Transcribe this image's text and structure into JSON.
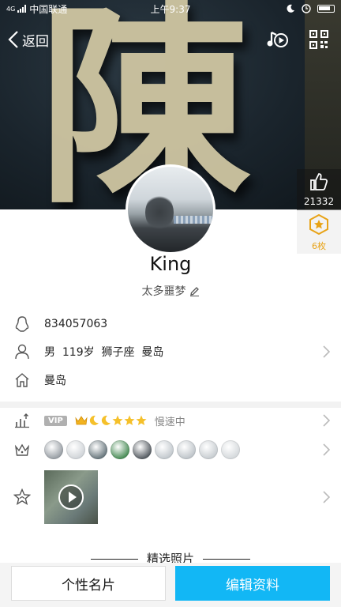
{
  "status_bar": {
    "network": "4G",
    "carrier": "中国联通",
    "time": "上午9:37"
  },
  "top_bar": {
    "back_label": "返回"
  },
  "cover": {
    "glyph": "陳"
  },
  "stats": {
    "likes": "21332",
    "badges": "6枚"
  },
  "profile": {
    "name": "King",
    "signature": "太多噩梦"
  },
  "info": {
    "qq_number": "834057063",
    "personal": "男  119岁  狮子座  曼岛",
    "hometown": "曼岛"
  },
  "level": {
    "vip_label": "VIP",
    "speed_text": "慢速中"
  },
  "medals": [
    {
      "icon": "penguin-medal-icon",
      "color": "#9aa0a6"
    },
    {
      "icon": "diamond-live-medal-icon",
      "color": "#d0d4d8"
    },
    {
      "icon": "penguin-star-medal-icon",
      "color": "#6c7a80"
    },
    {
      "icon": "penguin-gem-medal-icon",
      "color": "#4d8f5a"
    },
    {
      "icon": "penguin-crown-medal-icon",
      "color": "#5a6066"
    },
    {
      "icon": "vip-badge-medal-icon",
      "color": "#c3c9ce"
    },
    {
      "icon": "diamond-medal-icon",
      "color": "#bfc5ca"
    },
    {
      "icon": "star-medal-icon",
      "color": "#c8cdd1"
    },
    {
      "icon": "lightning-medal-icon",
      "color": "#d5d9dc"
    }
  ],
  "section": {
    "featured_title": "精选照片"
  },
  "bottom": {
    "card_label": "个性名片",
    "edit_label": "编辑资料"
  },
  "colors": {
    "accent": "#12b7f5",
    "gold": "#e8a317"
  }
}
